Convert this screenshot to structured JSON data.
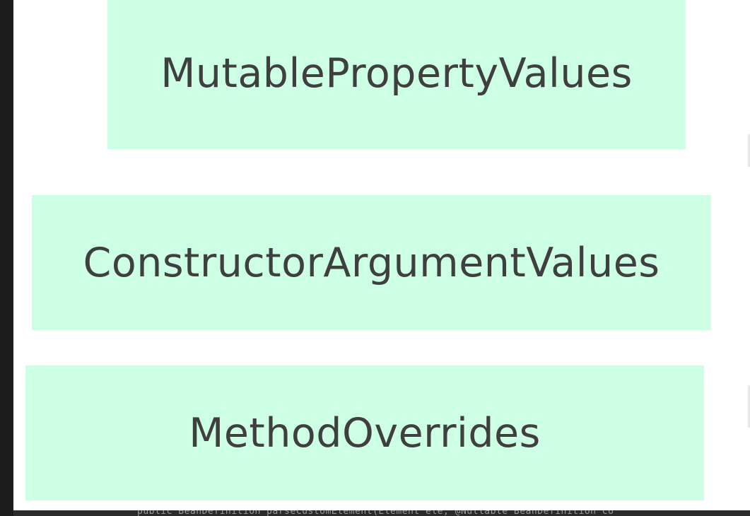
{
  "diagram": {
    "nodes": [
      {
        "id": "mpv",
        "label": "MutablePropertyValues"
      },
      {
        "id": "cav",
        "label": "ConstructorArgumentValues"
      },
      {
        "id": "mo",
        "label": "MethodOverrides"
      }
    ]
  },
  "code_strip": {
    "text": "public BeanDefinition parseCustomElement(Element ele, @Nullable BeanDefinition co"
  },
  "colors": {
    "node_fill": "#ccffe3",
    "node_text": "#3f3f3f",
    "canvas": "#ffffff",
    "editor_bg": "#2b2b2b"
  }
}
